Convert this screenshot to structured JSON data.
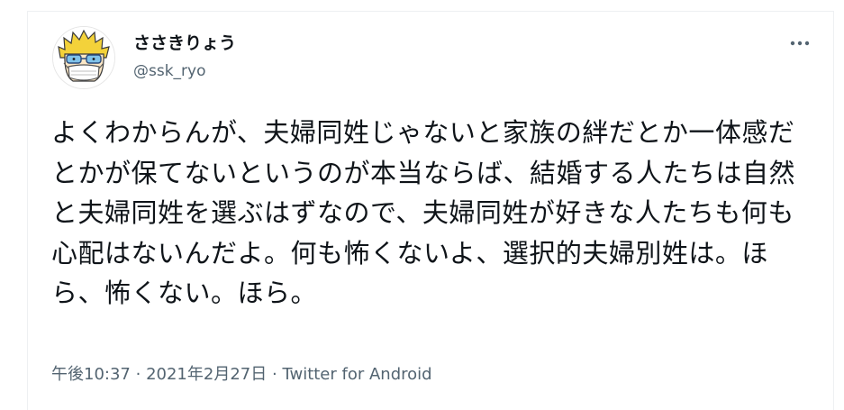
{
  "tweet": {
    "author": {
      "display_name": "ささきりょう",
      "handle": "@ssk_ryo",
      "avatar_icon": "cartoon-avatar-icon"
    },
    "more_icon": "more-horizontal-icon",
    "text": "よくわからんが、夫婦同姓じゃないと家族の絆だとか一体感だとかが保てないというのが本当ならば、結婚する人たちは自然と夫婦同姓を選ぶはずなので、夫婦同姓が好きな人たちも何も心配はないんだよ。何も怖くないよ、選択的夫婦別姓は。ほら、怖くない。ほら。",
    "time": "午後10:37",
    "separator": "·",
    "date": "2021年2月27日",
    "source": "Twitter for Android"
  },
  "colors": {
    "text_primary": "#0f1419",
    "text_secondary": "#536471",
    "border": "#eef0f2"
  }
}
